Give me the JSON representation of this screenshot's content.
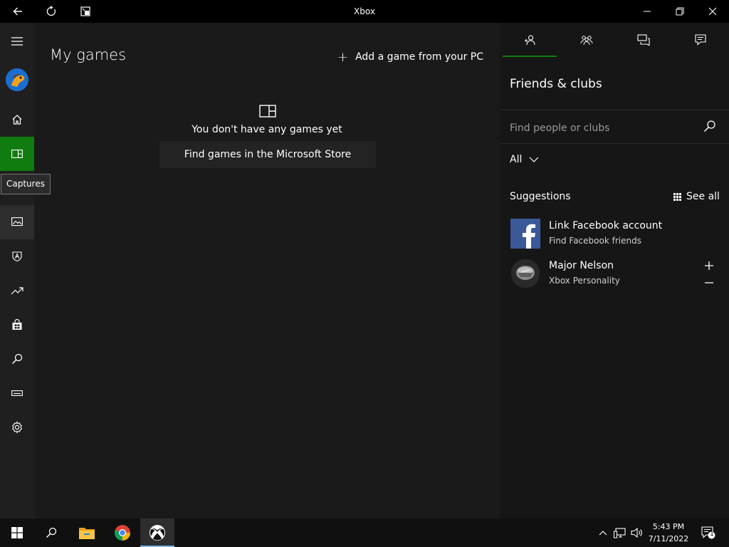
{
  "titlebar": {
    "title": "Xbox",
    "icons": [
      "back-arrow-icon",
      "refresh-icon",
      "compact-overlay-icon",
      "minimize-icon",
      "restore-icon",
      "close-icon"
    ]
  },
  "nav": {
    "tooltip": "Captures",
    "accent_color": "#107c10",
    "items": [
      {
        "name": "menu",
        "icon": "hamburger-menu-icon"
      },
      {
        "name": "profile",
        "icon": "avatar"
      },
      {
        "name": "home",
        "icon": "home-icon"
      },
      {
        "name": "my-games",
        "icon": "my-games-icon",
        "active": true
      },
      {
        "name": "captures",
        "icon": "captures-icon"
      },
      {
        "name": "achievements",
        "icon": "achievements-icon"
      },
      {
        "name": "trending",
        "icon": "trending-icon"
      },
      {
        "name": "store",
        "icon": "store-bag-icon"
      },
      {
        "name": "search",
        "icon": "search-icon"
      },
      {
        "name": "connection",
        "icon": "console-icon"
      },
      {
        "name": "settings",
        "icon": "gear-icon"
      }
    ]
  },
  "main": {
    "title": "My games",
    "add_game_label": "Add a game from your PC",
    "empty_text": "You don't have any games yet",
    "store_button_label": "Find games in the Microsoft Store"
  },
  "right_panel": {
    "tabs": [
      "friends-tab",
      "clubs-tab",
      "messages-tab",
      "activity-tab"
    ],
    "title": "Friends & clubs",
    "search_placeholder": "Find people or clubs",
    "filter_value": "All",
    "suggestions_label": "Suggestions",
    "see_all_label": "See all",
    "suggestions": [
      {
        "name": "Link Facebook account",
        "subtitle": "Find Facebook friends"
      },
      {
        "name": "Major Nelson",
        "subtitle": "Xbox Personality"
      }
    ]
  },
  "taskbar": {
    "time": "5:43 PM",
    "date": "7/11/2022",
    "notification_count": "1",
    "apps": [
      "start-icon",
      "search-icon",
      "file-explorer-icon",
      "chrome-icon",
      "xbox-icon"
    ]
  }
}
